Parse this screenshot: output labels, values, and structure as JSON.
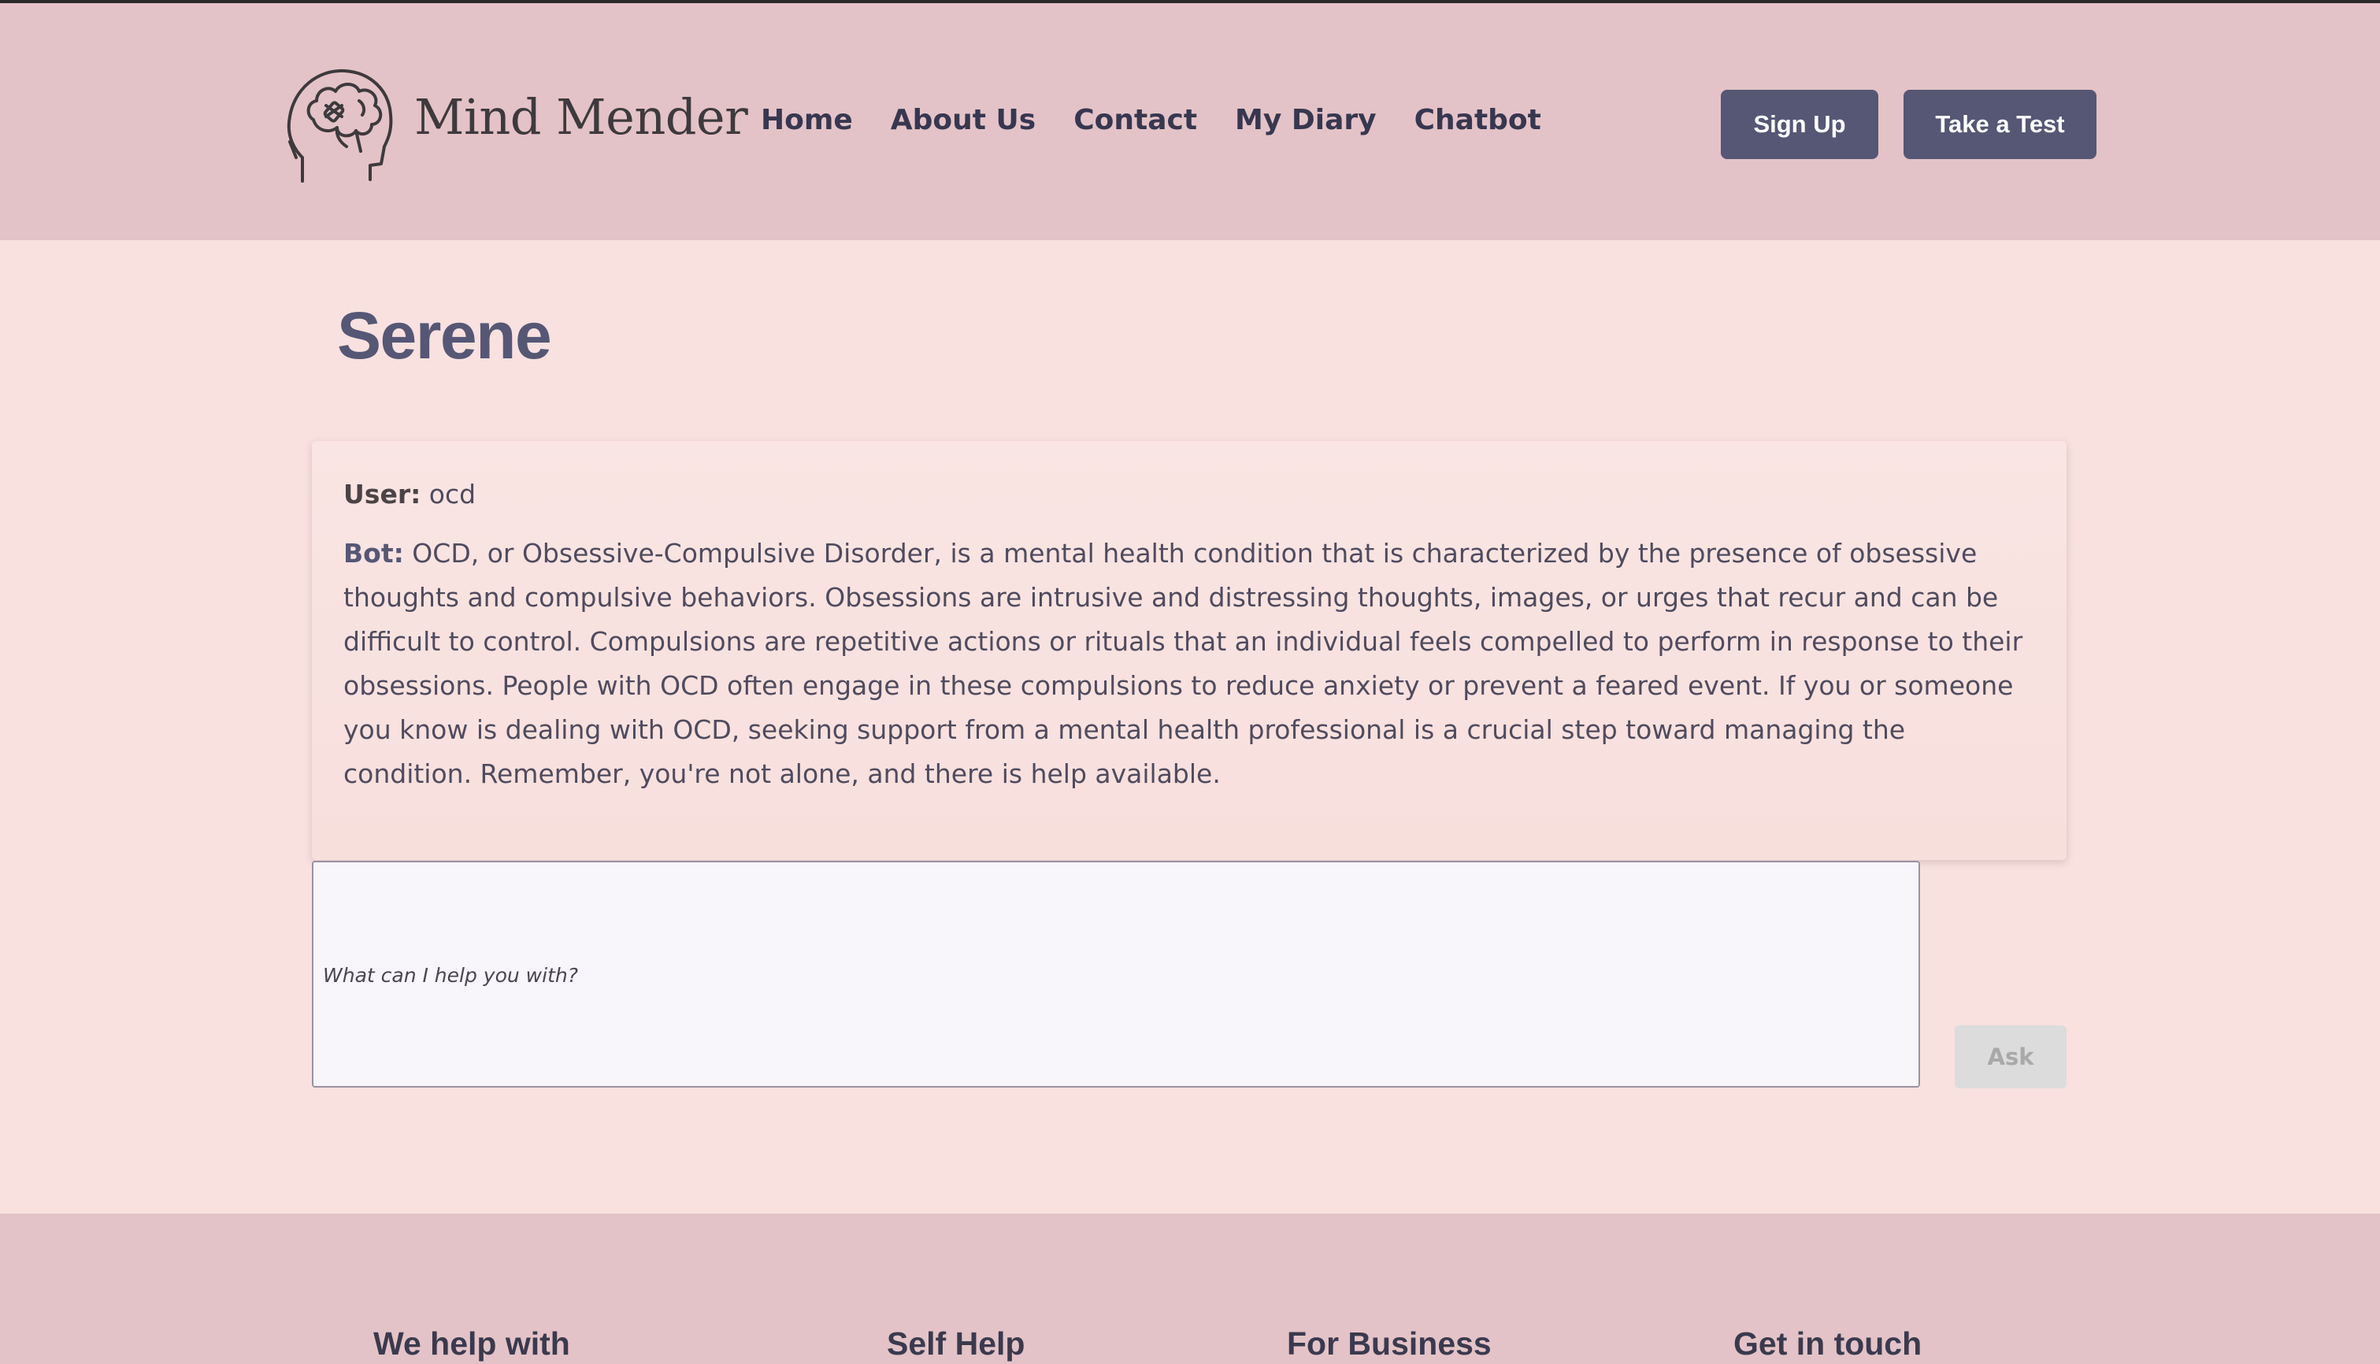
{
  "header": {
    "brand": "Mind Mender",
    "logo_icon": "head-brain-bandage-icon",
    "nav": [
      "Home",
      "About Us",
      "Contact",
      "My Diary",
      "Chatbot"
    ],
    "signup_label": "Sign Up",
    "test_label": "Take a Test"
  },
  "main": {
    "title": "Serene",
    "conversation": {
      "user_label": "User:",
      "user_text": "ocd",
      "bot_label": "Bot:",
      "bot_text": "OCD, or Obsessive-Compulsive Disorder, is a mental health condition that is characterized by the presence of obsessive thoughts and compulsive behaviors. Obsessions are intrusive and distressing thoughts, images, or urges that recur and can be difficult to control. Compulsions are repetitive actions or rituals that an individual feels compelled to perform in response to their obsessions. People with OCD often engage in these compulsions to reduce anxiety or prevent a feared event. If you or someone you know is dealing with OCD, seeking support from a mental health professional is a crucial step toward managing the condition. Remember, you're not alone, and there is help available."
    },
    "input_placeholder": "What can I help you with?",
    "ask_label": "Ask"
  },
  "footer": {
    "columns": [
      "We help with",
      "Self Help",
      "For Business",
      "Get in touch"
    ]
  },
  "colors": {
    "header_bg": "#e3c3c7",
    "page_bg": "#f8e1df",
    "accent": "#555775",
    "disabled_button": "#dcdcdc"
  }
}
